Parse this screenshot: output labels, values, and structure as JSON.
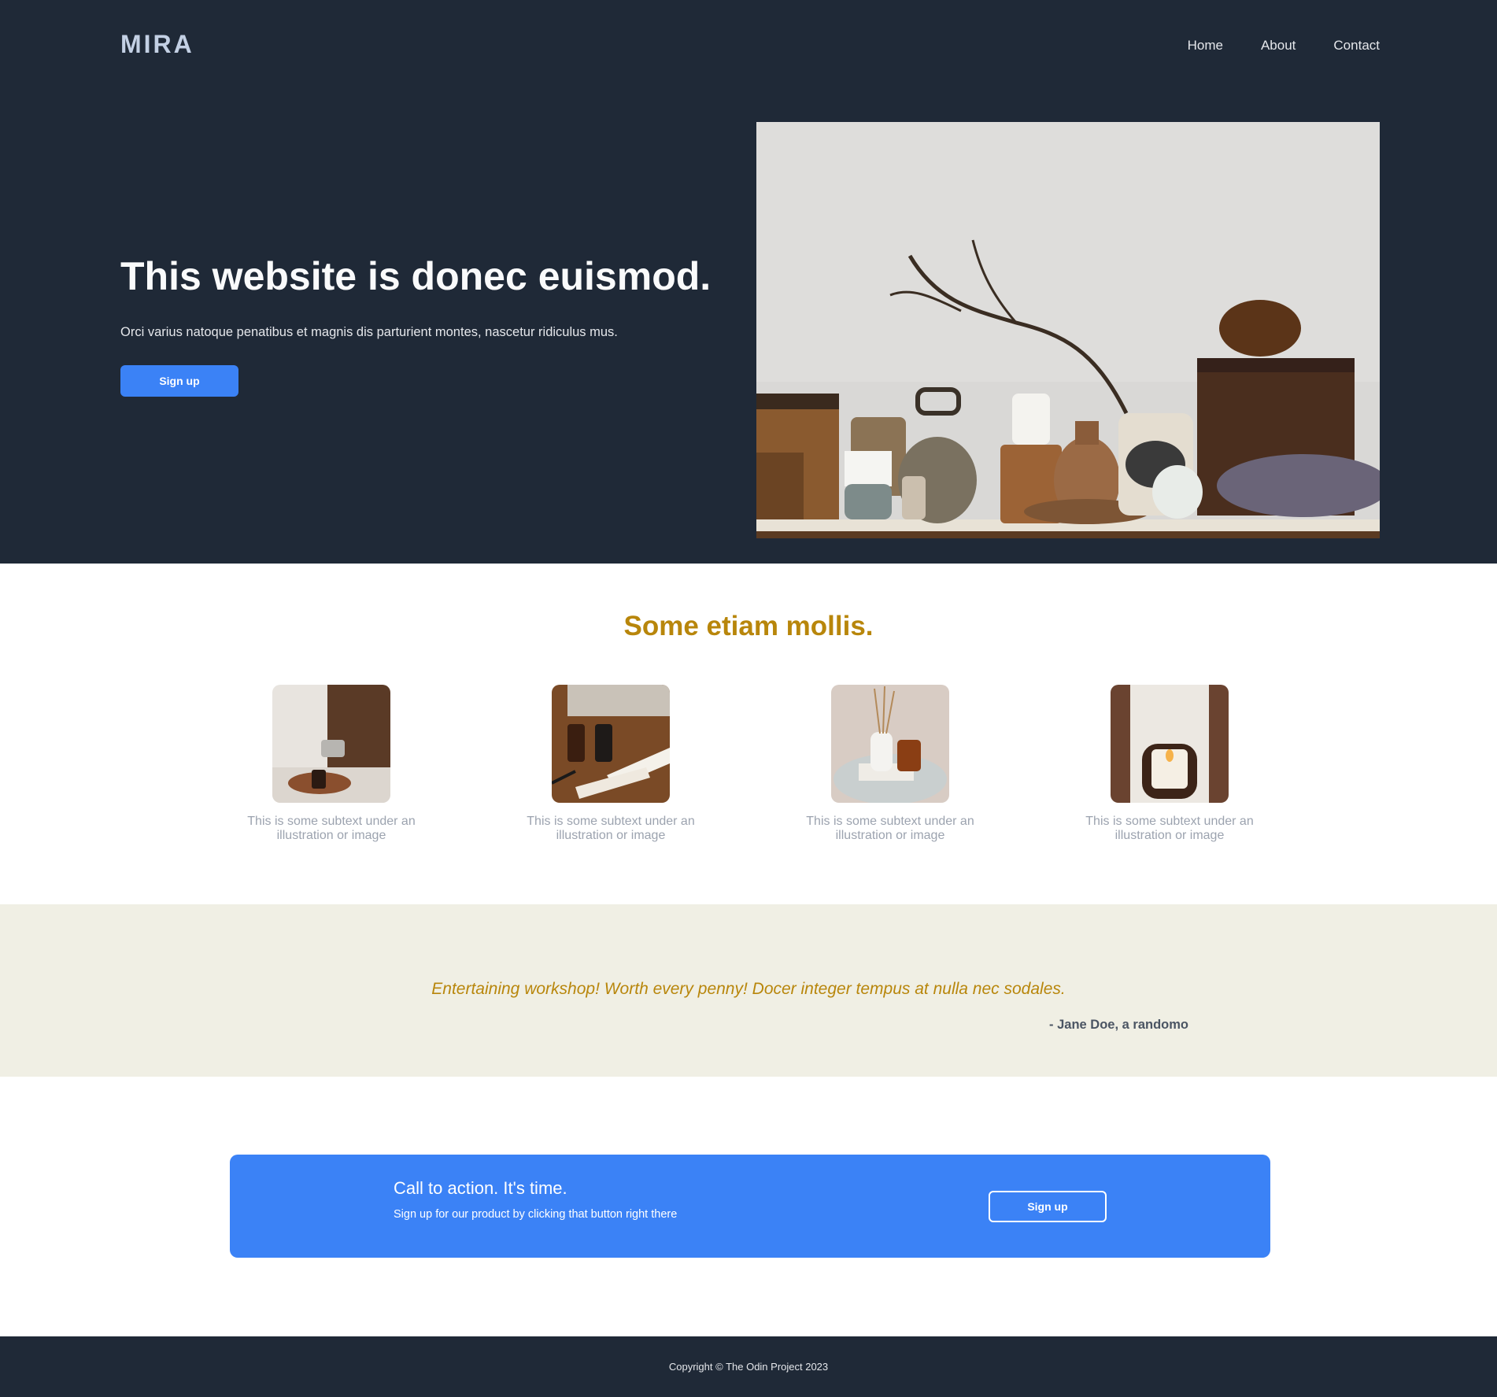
{
  "header": {
    "logo": "MIRA",
    "nav": [
      "Home",
      "About",
      "Contact"
    ]
  },
  "hero": {
    "title": "This website is donec euismod.",
    "subtitle": "Orci varius natoque penatibus et magnis dis parturient montes, nascetur ridiculus mus.",
    "button_label": "Sign up",
    "image_icon": "still-life-shelf-photo"
  },
  "features": {
    "title": "Some etiam mollis.",
    "items": [
      {
        "caption": "This is some subtext under an illustration or image",
        "image_icon": "pouring-candle-photo"
      },
      {
        "caption": "This is some subtext under an illustration or image",
        "image_icon": "perfume-bottles-photo"
      },
      {
        "caption": "This is some subtext under an illustration or image",
        "image_icon": "reed-diffuser-photo"
      },
      {
        "caption": "This is some subtext under an illustration or image",
        "image_icon": "candle-in-hands-photo"
      }
    ]
  },
  "quote": {
    "text": "Entertaining workshop! Worth every penny! Docer integer tempus at nulla nec sodales.",
    "author": "- Jane Doe, a randomo"
  },
  "cta": {
    "title": "Call to action. It's time.",
    "subtitle": "Sign up for our product by clicking that button right there",
    "button_label": "Sign up"
  },
  "footer": {
    "text": "Copyright © The Odin Project 2023"
  },
  "colors": {
    "dark": "#1f2937",
    "accent": "#3b82f6",
    "gold": "#b8860b",
    "quote_bg": "#f0efe4",
    "muted": "#9ca3af"
  }
}
